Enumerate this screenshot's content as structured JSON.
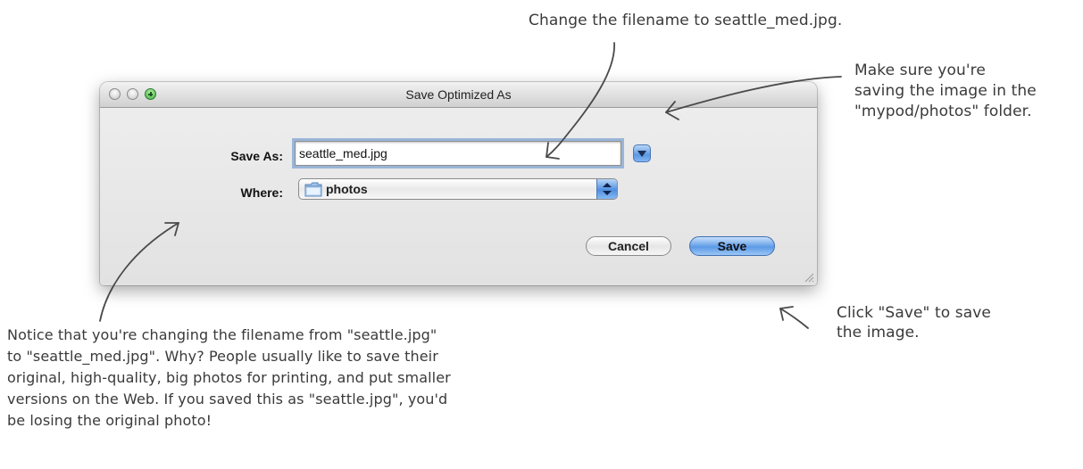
{
  "annotations": {
    "top": "Change the filename to seattle_med.jpg.",
    "right": [
      "Make sure you're",
      "saving the image in the",
      "\"mypod/photos\" folder."
    ],
    "save": [
      "Click \"Save\" to save",
      "the image."
    ],
    "bottom": [
      "Notice that you're changing the filename from \"seattle.jpg\"",
      "to \"seattle_med.jpg\". Why? People usually like to save their",
      "original, high-quality, big photos for printing, and put smaller",
      "versions on the Web. If you saved this as \"seattle.jpg\", you'd",
      "be losing the original photo!"
    ]
  },
  "dialog": {
    "title": "Save Optimized As",
    "save_as_label": "Save As:",
    "filename_value": "seattle_med.jpg",
    "where_label": "Where:",
    "where_value": "photos",
    "cancel_label": "Cancel",
    "save_label": "Save"
  },
  "icons": {
    "close": "close-icon",
    "minimize": "minimize-icon",
    "zoom": "zoom-icon",
    "expand": "chevron-down-icon",
    "folder": "folder-icon",
    "popup": "updown-arrows-icon",
    "resize": "resize-grip-icon"
  },
  "colors": {
    "accent_blue": "#5c97e2",
    "annotation_text": "#3a3a3a",
    "zoom_green": "#3cab3c"
  }
}
